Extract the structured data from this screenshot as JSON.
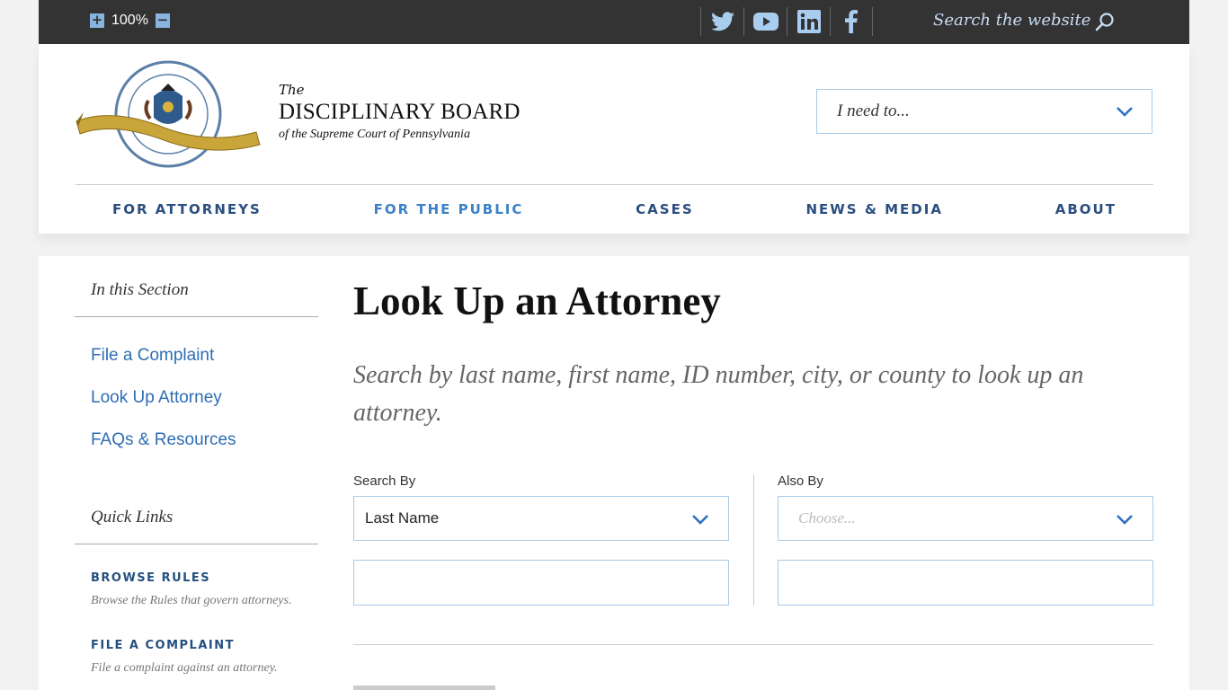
{
  "topbar": {
    "zoom_value": "100%",
    "zoom_in_label": "+",
    "zoom_out_label": "−",
    "social_icons": [
      "twitter-icon",
      "youtube-icon",
      "linkedin-icon",
      "facebook-icon"
    ],
    "search_placeholder": "Search the website"
  },
  "header": {
    "brand_the": "The",
    "brand_name": "DISCIPLINARY BOARD",
    "brand_sub": "of the Supreme Court of Pennsylvania",
    "ineed_label": "I need to..."
  },
  "nav": {
    "items": [
      {
        "label": "FOR ATTORNEYS"
      },
      {
        "label": "FOR THE PUBLIC"
      },
      {
        "label": "CASES"
      },
      {
        "label": "NEWS & MEDIA"
      },
      {
        "label": "ABOUT"
      }
    ],
    "active_index": 1
  },
  "sidebar": {
    "section_heading": "In this Section",
    "links": [
      {
        "label": "File a Complaint"
      },
      {
        "label": "Look Up Attorney"
      },
      {
        "label": "FAQs & Resources"
      }
    ],
    "quick_links_heading": "Quick Links",
    "quick_links": [
      {
        "title": "BROWSE RULES",
        "desc": "Browse the Rules that govern attorneys."
      },
      {
        "title": "FILE A COMPLAINT",
        "desc": "File a complaint against an attorney."
      }
    ]
  },
  "main": {
    "title": "Look Up an Attorney",
    "intro": "Search by last name, first name, ID number, city, or county to look up an attorney.",
    "search_by_label": "Search By",
    "search_by_value": "Last Name",
    "also_by_label": "Also By",
    "also_by_placeholder": "Choose..."
  },
  "colors": {
    "topbar_bg": "#333333",
    "nav_text": "#2a4e80",
    "link": "#2e6db4",
    "accent": "#3a82c8"
  }
}
